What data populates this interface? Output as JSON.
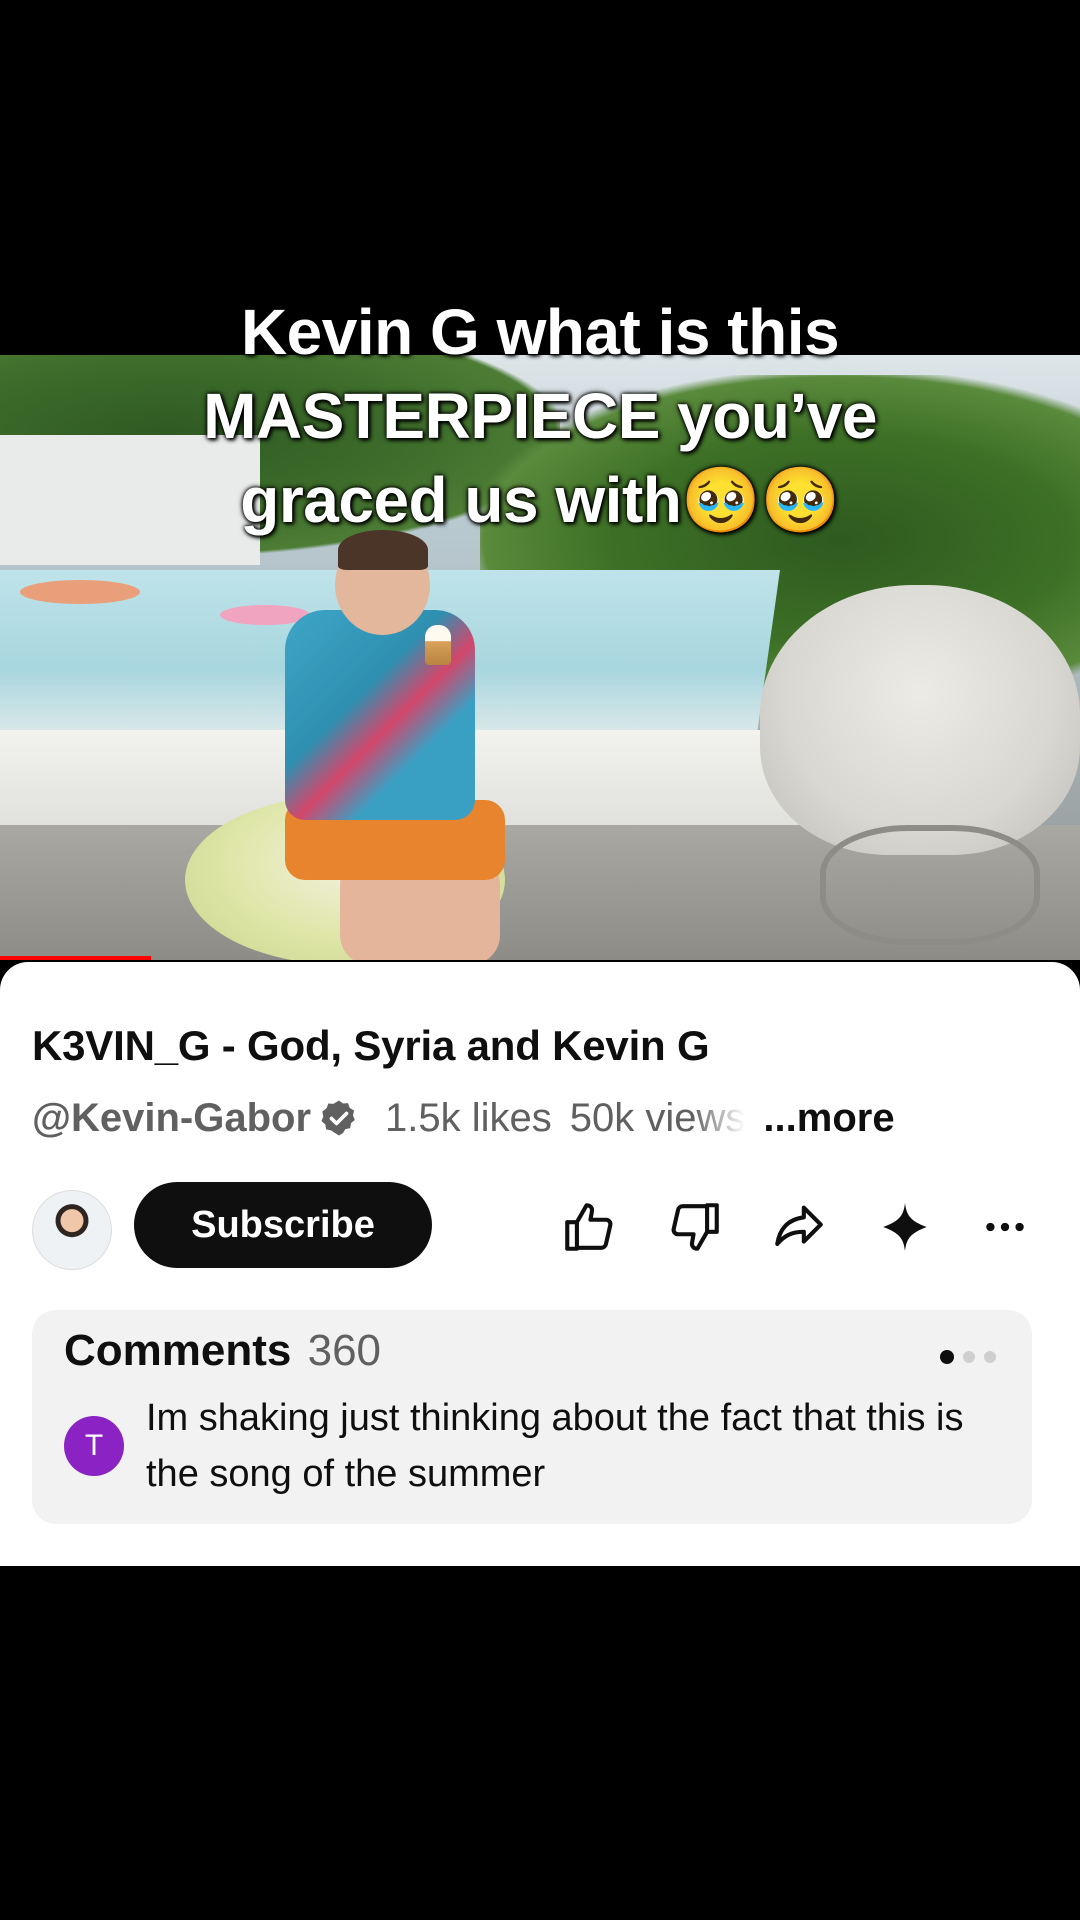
{
  "overlay": {
    "caption_lines": [
      "Kevin G what is this",
      "MASTERPIECE you’ve",
      "graced us with🥹🥹"
    ]
  },
  "video": {
    "progress_fraction": 0.14,
    "progress_color": "#ff0000"
  },
  "info": {
    "title": "K3VIN_G - God, Syria and Kevin G",
    "channel_handle": "@Kevin-Gabor",
    "likes": "1.5k likes",
    "views": "50k views",
    "more_label": "...more"
  },
  "actions": {
    "subscribe_label": "Subscribe",
    "icons": [
      "like-icon",
      "dislike-icon",
      "share-icon",
      "sparkle-icon",
      "more-icon"
    ]
  },
  "comments": {
    "label": "Comments",
    "count": "360",
    "preview": {
      "avatar_initial": "T",
      "avatar_color": "#8b22c4",
      "text": "Im shaking just thinking about the fact that this is the song of the summer"
    }
  },
  "colors": {
    "subscribe_bg": "#0f0f0f",
    "card_bg": "#ffffff",
    "comments_bg": "#f2f2f2"
  }
}
